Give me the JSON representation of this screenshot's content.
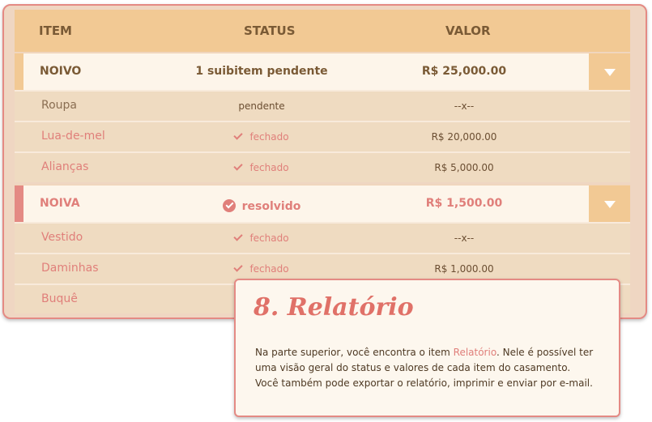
{
  "header": {
    "item": "ITEM",
    "status": "STATUS",
    "valor": "VALOR"
  },
  "groups": [
    {
      "name": "NOIVO",
      "status": "1 suibitem pendente",
      "value": "R$ 25,000.00",
      "bar_color": "#f2c994",
      "name_color": "#7a5a35",
      "rows": [
        {
          "name": "Roupa",
          "status": "pendente",
          "value": "--x--"
        },
        {
          "name": "Lua-de-mel",
          "status": "fechado",
          "value": "R$ 20,000.00"
        },
        {
          "name": "Alianças",
          "status": "fechado",
          "value": "R$ 5,000.00"
        }
      ]
    },
    {
      "name": "NOIVA",
      "status": "resolvido",
      "value": "R$ 1,500.00",
      "bar_color": "#e48a84",
      "name_color": "#e07f7a",
      "rows": [
        {
          "name": "Vestido",
          "status": "fechado",
          "value": "--x--"
        },
        {
          "name": "Daminhas",
          "status": "fechado",
          "value": "R$ 1,000.00"
        },
        {
          "name": "Buquê",
          "status": "",
          "value": ""
        }
      ]
    }
  ],
  "tip": {
    "title": "8. Relatório",
    "text_before": "Na parte superior, você encontra o item ",
    "highlight": "Relatório",
    "text_line1_after": ". Nele é possível ter",
    "line2": "uma visão geral do status e valores de cada item do casamento.",
    "line3": "Você também pode exportar o relatório, imprimir e enviar por e-mail."
  },
  "colors": {
    "accent": "#e07f7a",
    "header": "#f2c994",
    "text_dark": "#7a5a35"
  }
}
